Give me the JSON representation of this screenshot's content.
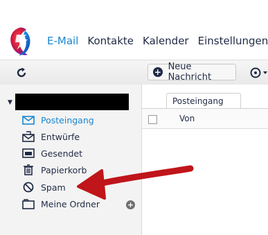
{
  "nav": {
    "email": "E-Mail",
    "contacts": "Kontakte",
    "calendar": "Kalender",
    "settings": "Einstellungen"
  },
  "toolbar": {
    "new_message": "Neue Nachricht"
  },
  "sidebar": {
    "folders": [
      {
        "label": "Posteingang",
        "icon": "inbox-icon",
        "active": true
      },
      {
        "label": "Entwürfe",
        "icon": "drafts-icon"
      },
      {
        "label": "Gesendet",
        "icon": "sent-icon"
      },
      {
        "label": "Papierkorb",
        "icon": "trash-icon"
      },
      {
        "label": "Spam",
        "icon": "spam-icon"
      },
      {
        "label": "Meine Ordner",
        "icon": "folder-icon"
      }
    ]
  },
  "main": {
    "tab_label": "Posteingang",
    "column_from": "Von"
  },
  "colors": {
    "accent": "#1a86d0",
    "text": "#1f2a44",
    "annotation_arrow": "#c0151a"
  }
}
